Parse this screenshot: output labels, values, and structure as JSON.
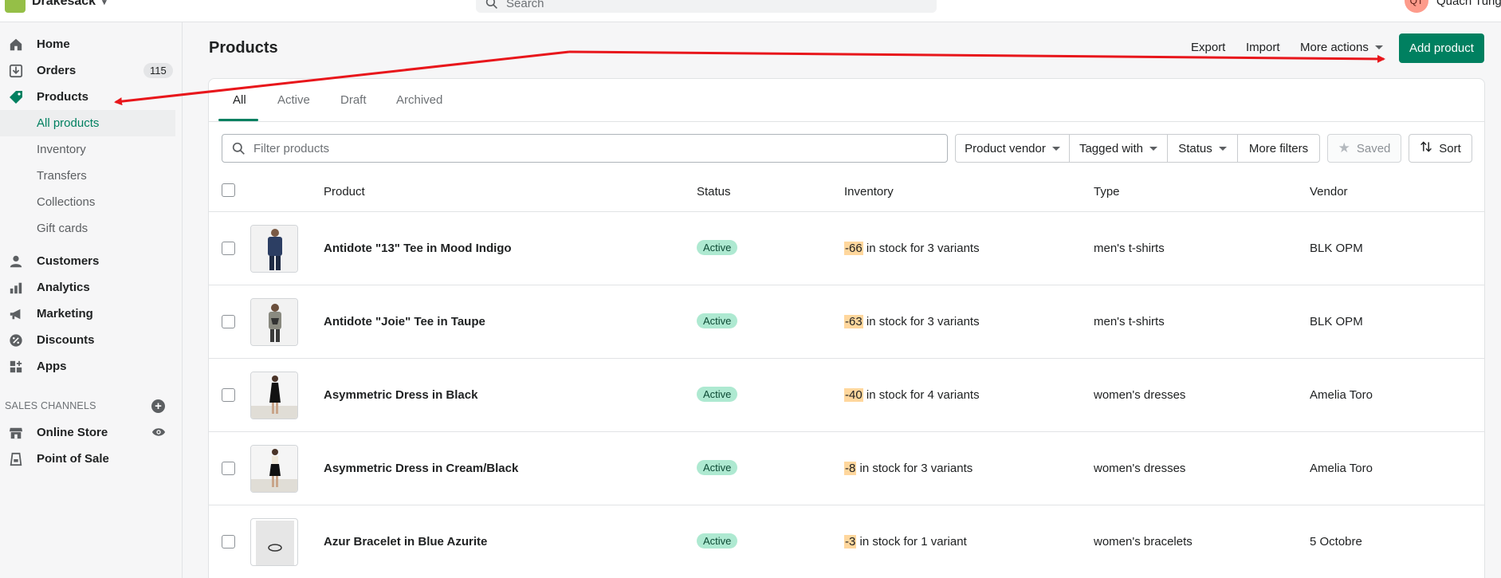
{
  "topbar": {
    "store_name": "Drakesack",
    "search_placeholder": "Search",
    "user_initials": "QT",
    "user_name": "Quach Tung"
  },
  "sidebar": {
    "items": [
      {
        "label": "Home",
        "icon": "home-icon"
      },
      {
        "label": "Orders",
        "icon": "orders-icon",
        "badge": "115"
      },
      {
        "label": "Products",
        "icon": "tag-icon"
      },
      {
        "label": "All products"
      },
      {
        "label": "Inventory"
      },
      {
        "label": "Transfers"
      },
      {
        "label": "Collections"
      },
      {
        "label": "Gift cards"
      },
      {
        "label": "Customers",
        "icon": "person-icon"
      },
      {
        "label": "Analytics",
        "icon": "bar-chart-icon"
      },
      {
        "label": "Marketing",
        "icon": "megaphone-icon"
      },
      {
        "label": "Discounts",
        "icon": "discount-icon"
      },
      {
        "label": "Apps",
        "icon": "apps-icon"
      }
    ],
    "sales_channels_header": "SALES CHANNELS",
    "channels": [
      {
        "label": "Online Store",
        "icon": "store-icon"
      },
      {
        "label": "Point of Sale",
        "icon": "pos-icon"
      }
    ]
  },
  "header": {
    "title": "Products",
    "export": "Export",
    "import": "Import",
    "more_actions": "More actions",
    "add_product": "Add product"
  },
  "tabs": [
    "All",
    "Active",
    "Draft",
    "Archived"
  ],
  "filters": {
    "placeholder": "Filter products",
    "vendor": "Product vendor",
    "tagged": "Tagged with",
    "status": "Status",
    "more": "More filters",
    "saved": "Saved",
    "sort": "Sort"
  },
  "table": {
    "columns": [
      "Product",
      "Status",
      "Inventory",
      "Type",
      "Vendor"
    ],
    "rows": [
      {
        "name": "Antidote \"13\" Tee in Mood Indigo",
        "status": "Active",
        "inv_num": "-66",
        "inv_rest": " in stock for 3 variants",
        "type": "men's t-shirts",
        "vendor": "BLK OPM"
      },
      {
        "name": "Antidote \"Joie\" Tee in Taupe",
        "status": "Active",
        "inv_num": "-63",
        "inv_rest": " in stock for 3 variants",
        "type": "men's t-shirts",
        "vendor": "BLK OPM"
      },
      {
        "name": "Asymmetric Dress in Black",
        "status": "Active",
        "inv_num": "-40",
        "inv_rest": " in stock for 4 variants",
        "type": "women's dresses",
        "vendor": "Amelia Toro"
      },
      {
        "name": "Asymmetric Dress in Cream/Black",
        "status": "Active",
        "inv_num": "-8",
        "inv_rest": " in stock for 3 variants",
        "type": "women's dresses",
        "vendor": "Amelia Toro"
      },
      {
        "name": "Azur Bracelet in Blue Azurite",
        "status": "Active",
        "inv_num": "-3",
        "inv_rest": " in stock for 1 variant",
        "type": "women's bracelets",
        "vendor": "5 Octobre"
      }
    ]
  },
  "colors": {
    "accent": "#008060",
    "annotation_arrow": "#e8161b",
    "status_active_bg": "#aee9d1",
    "inventory_negative_bg": "#ffd79d"
  }
}
